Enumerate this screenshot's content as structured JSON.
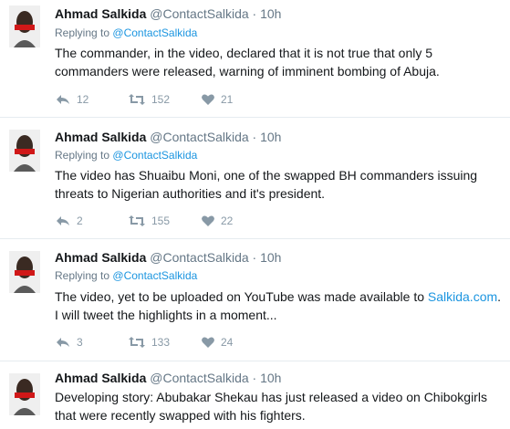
{
  "tweets": [
    {
      "name": "Ahmad Salkida",
      "handle": "@ContactSalkida",
      "separator": "·",
      "time": "10h",
      "reply_label": "Replying to",
      "reply_handle": "@ContactSalkida",
      "text": "The commander, in the video, declared that it is not true that only 5 commanders were released, warning of imminent bombing of Abuja.",
      "replies": "12",
      "retweets": "152",
      "likes": "21"
    },
    {
      "name": "Ahmad Salkida",
      "handle": "@ContactSalkida",
      "separator": "·",
      "time": "10h",
      "reply_label": "Replying to",
      "reply_handle": "@ContactSalkida",
      "text": "The video has Shuaibu Moni, one of the swapped BH commanders issuing threats to Nigerian authorities and it's president.",
      "replies": "2",
      "retweets": "155",
      "likes": "22"
    },
    {
      "name": "Ahmad Salkida",
      "handle": "@ContactSalkida",
      "separator": "·",
      "time": "10h",
      "reply_label": "Replying to",
      "reply_handle": "@ContactSalkida",
      "text_before": "The video, yet to be uploaded on YouTube was made available to ",
      "text_link": "Salkida.com",
      "text_after": ". I will tweet the highlights in a moment...",
      "replies": "3",
      "retweets": "133",
      "likes": "24"
    },
    {
      "name": "Ahmad Salkida",
      "handle": "@ContactSalkida",
      "separator": "·",
      "time": "10h",
      "text": "Developing story: Abubakar Shekau has just released a video on Chibokgirls that were recently swapped with his fighters."
    }
  ],
  "colors": {
    "link": "#1b95e0",
    "secondary": "#657786",
    "icon": "#8899a6",
    "divider": "#e6ecf0"
  },
  "icons": [
    "reply-icon",
    "retweet-icon",
    "like-icon"
  ]
}
